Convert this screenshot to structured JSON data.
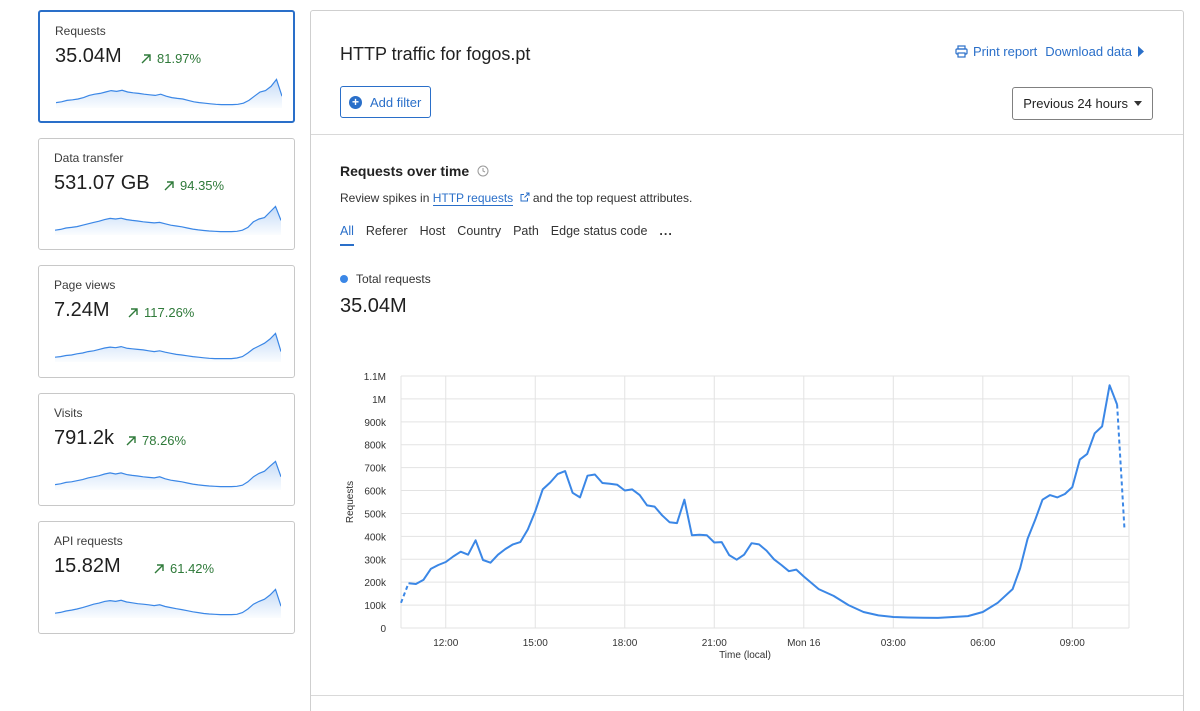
{
  "sidebar": {
    "cards": [
      {
        "label": "Requests",
        "value": "35.04M",
        "change": "81.97%"
      },
      {
        "label": "Data transfer",
        "value": "531.07 GB",
        "change": "94.35%"
      },
      {
        "label": "Page views",
        "value": "7.24M",
        "change": "117.26%"
      },
      {
        "label": "Visits",
        "value": "791.2k",
        "change": "78.26%"
      },
      {
        "label": "API requests",
        "value": "15.82M",
        "change": "61.42%"
      }
    ]
  },
  "header": {
    "title": "HTTP traffic for fogos.pt",
    "print_label": "Print report",
    "download_label": "Download data",
    "add_filter_label": "Add filter",
    "time_range": "Previous 24 hours"
  },
  "section": {
    "title": "Requests over time",
    "desc_prefix": "Review spikes in ",
    "desc_link": "HTTP requests",
    "desc_suffix": " and the top request attributes.",
    "tabs": [
      "All",
      "Referer",
      "Host",
      "Country",
      "Path",
      "Edge status code"
    ],
    "more_label": "...",
    "legend_label": "Total requests",
    "total_value": "35.04M"
  },
  "colors": {
    "accent": "#2a6fc9",
    "series": "#3b87e6",
    "positive": "#2f7a3a"
  },
  "chart_data": {
    "type": "line",
    "xlabel": "Time (local)",
    "ylabel": "Requests",
    "ylim": [
      0,
      1100000
    ],
    "yticks": [
      0,
      100000,
      200000,
      300000,
      400000,
      500000,
      600000,
      700000,
      800000,
      900000,
      1000000,
      1100000
    ],
    "ytick_labels": [
      "0",
      "100k",
      "200k",
      "300k",
      "400k",
      "500k",
      "600k",
      "700k",
      "800k",
      "900k",
      "1M",
      "1.1M"
    ],
    "xlim": [
      10.5,
      34.9
    ],
    "xticks": [
      12,
      15,
      18,
      21,
      24,
      27,
      30,
      33
    ],
    "xtick_labels": [
      "12:00",
      "15:00",
      "18:00",
      "21:00",
      "Mon 16",
      "03:00",
      "06:00",
      "09:00"
    ],
    "grid": true,
    "series": [
      {
        "name": "Total requests",
        "x": [
          10.75,
          11.0,
          11.25,
          11.5,
          11.75,
          12.0,
          12.25,
          12.5,
          12.75,
          13.0,
          13.25,
          13.5,
          13.75,
          14.0,
          14.25,
          14.5,
          14.75,
          15.0,
          15.25,
          15.5,
          15.75,
          16.0,
          16.25,
          16.5,
          16.75,
          17.0,
          17.25,
          17.5,
          17.75,
          18.0,
          18.25,
          18.5,
          18.75,
          19.0,
          19.25,
          19.5,
          19.75,
          20.0,
          20.25,
          20.5,
          20.75,
          21.0,
          21.25,
          21.5,
          21.75,
          22.0,
          22.25,
          22.5,
          22.75,
          23.0,
          23.25,
          23.5,
          23.75,
          24.0,
          24.5,
          25.0,
          25.5,
          26.0,
          26.5,
          27.0,
          27.5,
          28.0,
          28.5,
          29.0,
          29.5,
          30.0,
          30.5,
          31.0,
          31.25,
          31.5,
          31.75,
          32.0,
          32.25,
          32.5,
          32.75,
          33.0,
          33.25,
          33.5,
          33.75,
          34.0,
          34.25,
          34.5,
          34.75
        ],
        "values": [
          195000,
          192000,
          210000,
          258000,
          275000,
          288000,
          312000,
          333000,
          320000,
          383000,
          297000,
          285000,
          320000,
          345000,
          365000,
          375000,
          430000,
          510000,
          605000,
          635000,
          672000,
          685000,
          590000,
          570000,
          665000,
          670000,
          633000,
          630000,
          625000,
          600000,
          605000,
          580000,
          535000,
          530000,
          492000,
          462000,
          458000,
          560000,
          405000,
          407000,
          405000,
          373000,
          375000,
          318000,
          298000,
          320000,
          370000,
          365000,
          338000,
          300000,
          275000,
          248000,
          255000,
          225000,
          170000,
          140000,
          100000,
          70000,
          55000,
          48000,
          46000,
          45000,
          44000,
          48000,
          52000,
          70000,
          110000,
          170000,
          260000,
          390000,
          470000,
          560000,
          580000,
          570000,
          585000,
          615000,
          735000,
          760000,
          850000,
          880000,
          1060000,
          975000,
          430000
        ],
        "dashed_segments": [
          [
            10.5,
            10.75
          ],
          [
            34.5,
            34.75
          ]
        ],
        "start_value": 110000
      }
    ]
  },
  "sparklines": [
    [
      0.12,
      0.15,
      0.2,
      0.22,
      0.25,
      0.3,
      0.38,
      0.42,
      0.45,
      0.5,
      0.55,
      0.52,
      0.56,
      0.5,
      0.47,
      0.45,
      0.42,
      0.4,
      0.38,
      0.42,
      0.35,
      0.3,
      0.27,
      0.25,
      0.2,
      0.15,
      0.12,
      0.1,
      0.08,
      0.06,
      0.05,
      0.05,
      0.05,
      0.06,
      0.1,
      0.2,
      0.35,
      0.5,
      0.55,
      0.7,
      0.95,
      0.35
    ],
    [
      0.1,
      0.13,
      0.18,
      0.2,
      0.23,
      0.28,
      0.33,
      0.38,
      0.42,
      0.48,
      0.52,
      0.5,
      0.53,
      0.48,
      0.45,
      0.43,
      0.4,
      0.38,
      0.36,
      0.38,
      0.33,
      0.28,
      0.25,
      0.22,
      0.18,
      0.14,
      0.11,
      0.09,
      0.07,
      0.06,
      0.05,
      0.05,
      0.05,
      0.06,
      0.1,
      0.2,
      0.4,
      0.5,
      0.55,
      0.75,
      0.95,
      0.45
    ],
    [
      0.1,
      0.12,
      0.16,
      0.18,
      0.22,
      0.25,
      0.3,
      0.33,
      0.38,
      0.43,
      0.46,
      0.44,
      0.48,
      0.42,
      0.4,
      0.38,
      0.36,
      0.33,
      0.3,
      0.33,
      0.28,
      0.24,
      0.2,
      0.18,
      0.15,
      0.12,
      0.1,
      0.08,
      0.06,
      0.05,
      0.05,
      0.05,
      0.05,
      0.07,
      0.12,
      0.25,
      0.4,
      0.5,
      0.6,
      0.75,
      0.95,
      0.3
    ],
    [
      0.12,
      0.15,
      0.2,
      0.22,
      0.26,
      0.3,
      0.36,
      0.4,
      0.44,
      0.5,
      0.54,
      0.5,
      0.54,
      0.48,
      0.45,
      0.43,
      0.4,
      0.38,
      0.36,
      0.4,
      0.33,
      0.28,
      0.25,
      0.22,
      0.18,
      0.14,
      0.11,
      0.09,
      0.07,
      0.06,
      0.05,
      0.05,
      0.05,
      0.06,
      0.1,
      0.22,
      0.4,
      0.52,
      0.6,
      0.78,
      0.95,
      0.4
    ],
    [
      0.1,
      0.13,
      0.18,
      0.21,
      0.25,
      0.3,
      0.36,
      0.42,
      0.46,
      0.52,
      0.55,
      0.52,
      0.56,
      0.5,
      0.47,
      0.44,
      0.42,
      0.4,
      0.37,
      0.4,
      0.34,
      0.3,
      0.26,
      0.23,
      0.19,
      0.15,
      0.12,
      0.09,
      0.07,
      0.06,
      0.05,
      0.05,
      0.05,
      0.06,
      0.12,
      0.25,
      0.42,
      0.52,
      0.6,
      0.75,
      0.95,
      0.35
    ]
  ]
}
